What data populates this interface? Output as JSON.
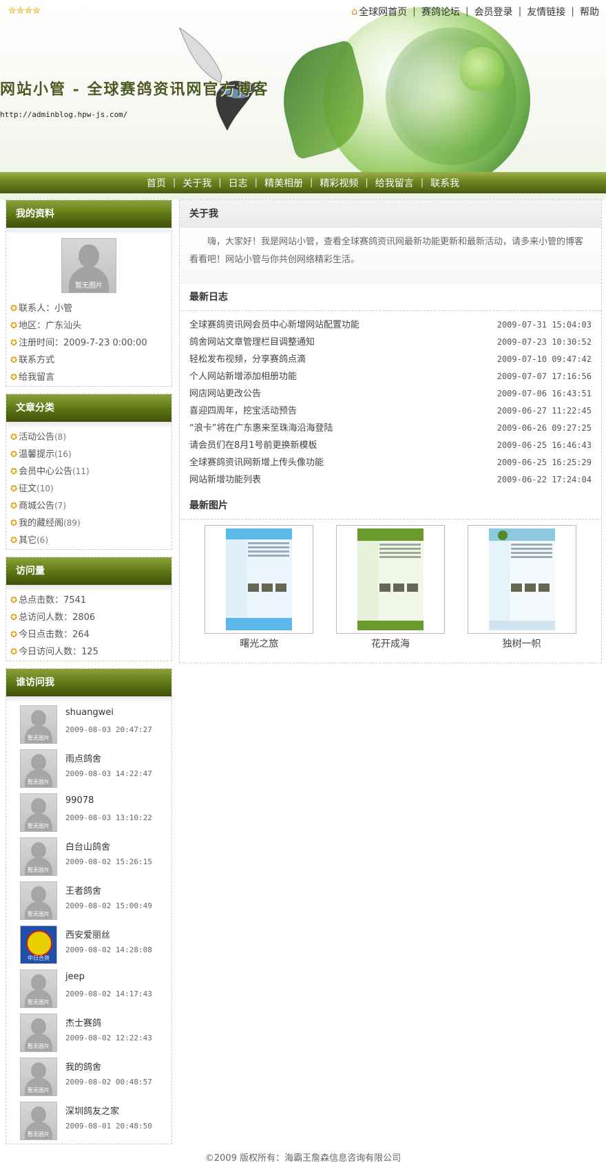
{
  "header": {
    "stars": "✮✮✮✮",
    "top_links": [
      "全球网首页",
      "赛鸽论坛",
      "会员登录",
      "友情链接",
      "帮助"
    ],
    "title": "网站小管 - 全球赛鸽资讯网官方博客",
    "url": "http://adminblog.hpw-js.com/"
  },
  "nav": [
    "首页",
    "关于我",
    "日志",
    "精美相册",
    "精彩视频",
    "给我留言",
    "联系我"
  ],
  "profile": {
    "heading": "我的资料",
    "avatar_caption": "暂无图片",
    "items": [
      "联系人：小管",
      "地区：广东汕头",
      "注册时间：2009-7-23 0:00:00",
      "联系方式",
      "给我留言"
    ]
  },
  "categories": {
    "heading": "文章分类",
    "items": [
      {
        "name": "活动公告",
        "count": "(8)"
      },
      {
        "name": "温馨提示",
        "count": "(16)"
      },
      {
        "name": "会员中心公告",
        "count": "(11)"
      },
      {
        "name": "征文",
        "count": "(10)"
      },
      {
        "name": "商城公告",
        "count": "(7)"
      },
      {
        "name": "我的藏经阁",
        "count": "(89)"
      },
      {
        "name": "其它",
        "count": "(6)"
      }
    ]
  },
  "stats": {
    "heading": "访问量",
    "items": [
      "总点击数：7541",
      "总访问人数：2806",
      "今日点击数：264",
      "今日访问人数：125"
    ]
  },
  "visitors": {
    "heading": "谁访问我",
    "avatar_caption": "暂无图片",
    "special_caption": "中日合资",
    "items": [
      {
        "name": "shuangwei",
        "time": "2009-08-03 20:47:27"
      },
      {
        "name": "雨点鸽舍",
        "time": "2009-08-03 14:22:47"
      },
      {
        "name": "99078",
        "time": "2009-08-03 13:10:22"
      },
      {
        "name": "白台山鸽舍",
        "time": "2009-08-02 15:26:15"
      },
      {
        "name": "王者鸽舍",
        "time": "2009-08-02 15:00:49"
      },
      {
        "name": "西安爱丽丝",
        "time": "2009-08-02 14:28:08"
      },
      {
        "name": "jeep",
        "time": "2009-08-02 14:17:43"
      },
      {
        "name": "杰士赛鸽",
        "time": "2009-08-02 12:22:43"
      },
      {
        "name": "我的鸽舍",
        "time": "2009-08-02 00:48:57"
      },
      {
        "name": "深圳鸽友之家",
        "time": "2009-08-01 20:48:50"
      }
    ]
  },
  "about": {
    "heading": "关于我",
    "text": "嗨，大家好！我是网站小管，查看全球赛鸽资讯网最新功能更新和最新活动，请多来小管的博客看看吧！网站小管与你共创网络精彩生活。"
  },
  "latest_logs": {
    "heading": "最新日志",
    "items": [
      {
        "title": "全球赛鸽资讯网会员中心新增网站配置功能",
        "date": "2009-07-31 15:04:03"
      },
      {
        "title": "鸽舍网站文章管理栏目调整通知",
        "date": "2009-07-23 10:30:52"
      },
      {
        "title": "轻松发布视频，分享赛鸽点滴",
        "date": "2009-07-10 09:47:42"
      },
      {
        "title": "个人网站新增添加相册功能",
        "date": "2009-07-07 17:16:56"
      },
      {
        "title": "网店网站更改公告",
        "date": "2009-07-06 16:43:51"
      },
      {
        "title": "喜迎四周年，挖宝活动预告",
        "date": "2009-06-27 11:22:45"
      },
      {
        "title": "“浪卡”将在广东惠来至珠海沿海登陆",
        "date": "2009-06-26 09:27:25"
      },
      {
        "title": "请会员们在8月1号前更换新模板",
        "date": "2009-06-25 16:46:43"
      },
      {
        "title": "全球赛鸽资讯网新增上传头像功能",
        "date": "2009-06-25 16:25:29"
      },
      {
        "title": "网站新增功能列表",
        "date": "2009-06-22 17:24:04"
      }
    ]
  },
  "latest_pics": {
    "heading": "最新图片",
    "items": [
      {
        "caption": "曙光之旅",
        "color": "#5cb8e8"
      },
      {
        "caption": "花开成海",
        "color": "#6a9a2c"
      },
      {
        "caption": "独树一帜",
        "color": "#8cc8e0"
      }
    ]
  },
  "footer": "©2009 版权所有：海霸王詹森信息咨询有限公司"
}
